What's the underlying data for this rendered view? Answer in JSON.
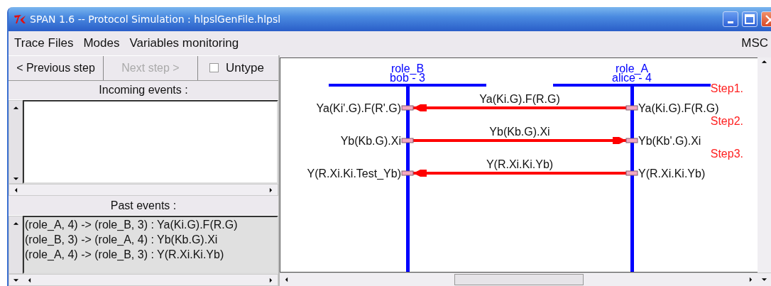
{
  "window": {
    "title": "SPAN 1.6 -- Protocol Simulation : hlpslGenFile.hlpsl"
  },
  "menu": [
    {
      "label": "Trace Files"
    },
    {
      "label": "Modes"
    },
    {
      "label": "Variables monitoring"
    }
  ],
  "menu_right": {
    "label": "MSC"
  },
  "toolbar": {
    "previous": {
      "label": "< Previous step",
      "disabled": false
    },
    "next": {
      "label": "Next step >",
      "disabled": true
    },
    "untype": {
      "label": "Untype",
      "checked": false
    }
  },
  "incoming_events": {
    "label": "Incoming events :"
  },
  "past_events": {
    "label": "Past events :",
    "items": [
      "(role_A, 4) -> (role_B, 3) : Ya(Ki.G).F(R.G)",
      "(role_B, 3) -> (role_A, 4) : Yb(Kb.G).Xi",
      "(role_A, 4) -> (role_B, 3) : Y(R.Xi.Ki.Yb)"
    ]
  },
  "msc": {
    "roles": [
      {
        "name": "role_B",
        "instance": "bob - 3"
      },
      {
        "name": "role_A",
        "instance": "alice - 4"
      }
    ],
    "messages": [
      {
        "step": "Step1.",
        "label": "Ya(Ki.G).F(R.G)",
        "kind": "leftward",
        "left_term": "Ya(Ki'.G).F(R'.G)",
        "right_term": "Ya(Ki.G).F(R.G)"
      },
      {
        "step": "Step2.",
        "label": "Yb(Kb.G).Xi",
        "kind": "rightward",
        "left_term": "Yb(Kb.G).Xi",
        "right_term": "Yb(Kb'.G).Xi"
      },
      {
        "step": "Step3.",
        "label": "Y(R.Xi.Ki.Yb)",
        "kind": "leftward",
        "left_term": "Y(R.Xi.Ki.Test_Yb)",
        "right_term": "Y(R.Xi.Ki.Yb)"
      }
    ]
  }
}
